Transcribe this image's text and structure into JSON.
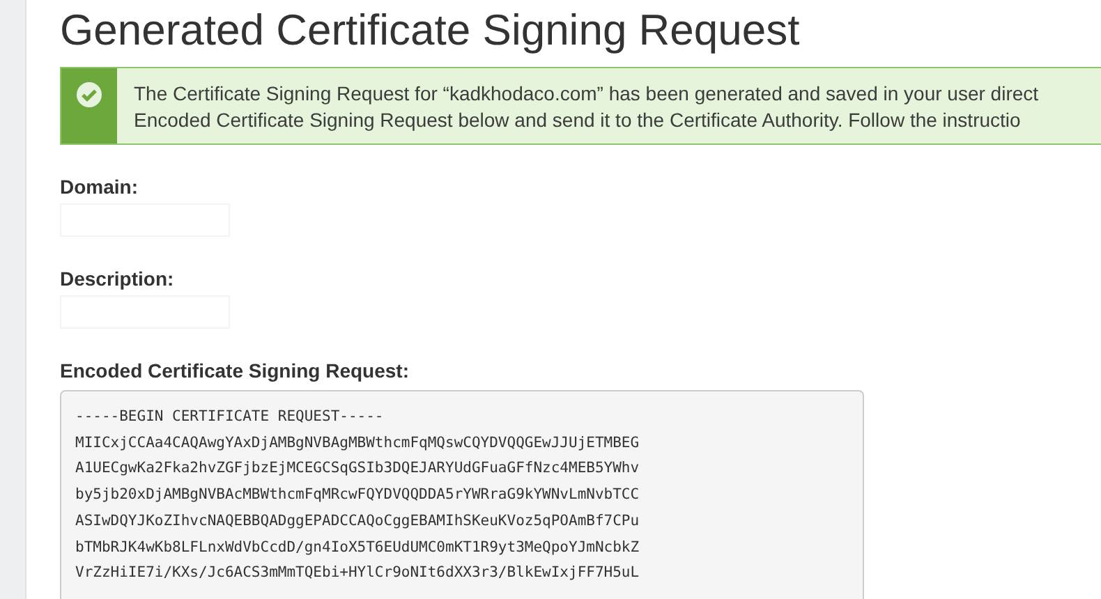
{
  "page": {
    "title": "Generated Certificate Signing Request"
  },
  "alert": {
    "kind": "success",
    "lines": [
      "The Certificate Signing Request for “kadkhodaco.com” has been generated and saved in your user direct",
      "Encoded Certificate Signing Request below and send it to the Certificate Authority. Follow the instructio"
    ]
  },
  "fields": [
    {
      "label": "Domain:"
    },
    {
      "label": "Description:"
    }
  ],
  "csr": {
    "label": "Encoded Certificate Signing Request:",
    "lines": [
      "-----BEGIN CERTIFICATE REQUEST-----",
      "MIICxjCCAa4CAQAwgYAxDjAMBgNVBAgMBWthcmFqMQswCQYDVQQGEwJJUjETMBEG",
      "A1UECgwKa2Fka2hvZGFjbzEjMCEGCSqGSIb3DQEJARYUdGFuaGFfNzc4MEB5YWhv",
      "by5jb20xDjAMBgNVBAcMBWthcmFqMRcwFQYDVQQDDA5rYWRraG9kYWNvLmNvbTCC",
      "ASIwDQYJKoZIhvcNAQEBBQADggEPADCCAQoCggEBAMIhSKeuKVoz5qPOAmBf7CPu",
      "bTMbRJK4wKb8LFLnxWdVbCcdD/gn4IoX5T6EUdUMC0mKT1R9yt3MeQpoYJmNcbkZ",
      "VrZzHiIE7i/KXs/Jc6ACS3mMmTQEbi+HYlCr9oNIt6dXX3r3/BlkEwIxjFF7H5uL"
    ]
  }
}
